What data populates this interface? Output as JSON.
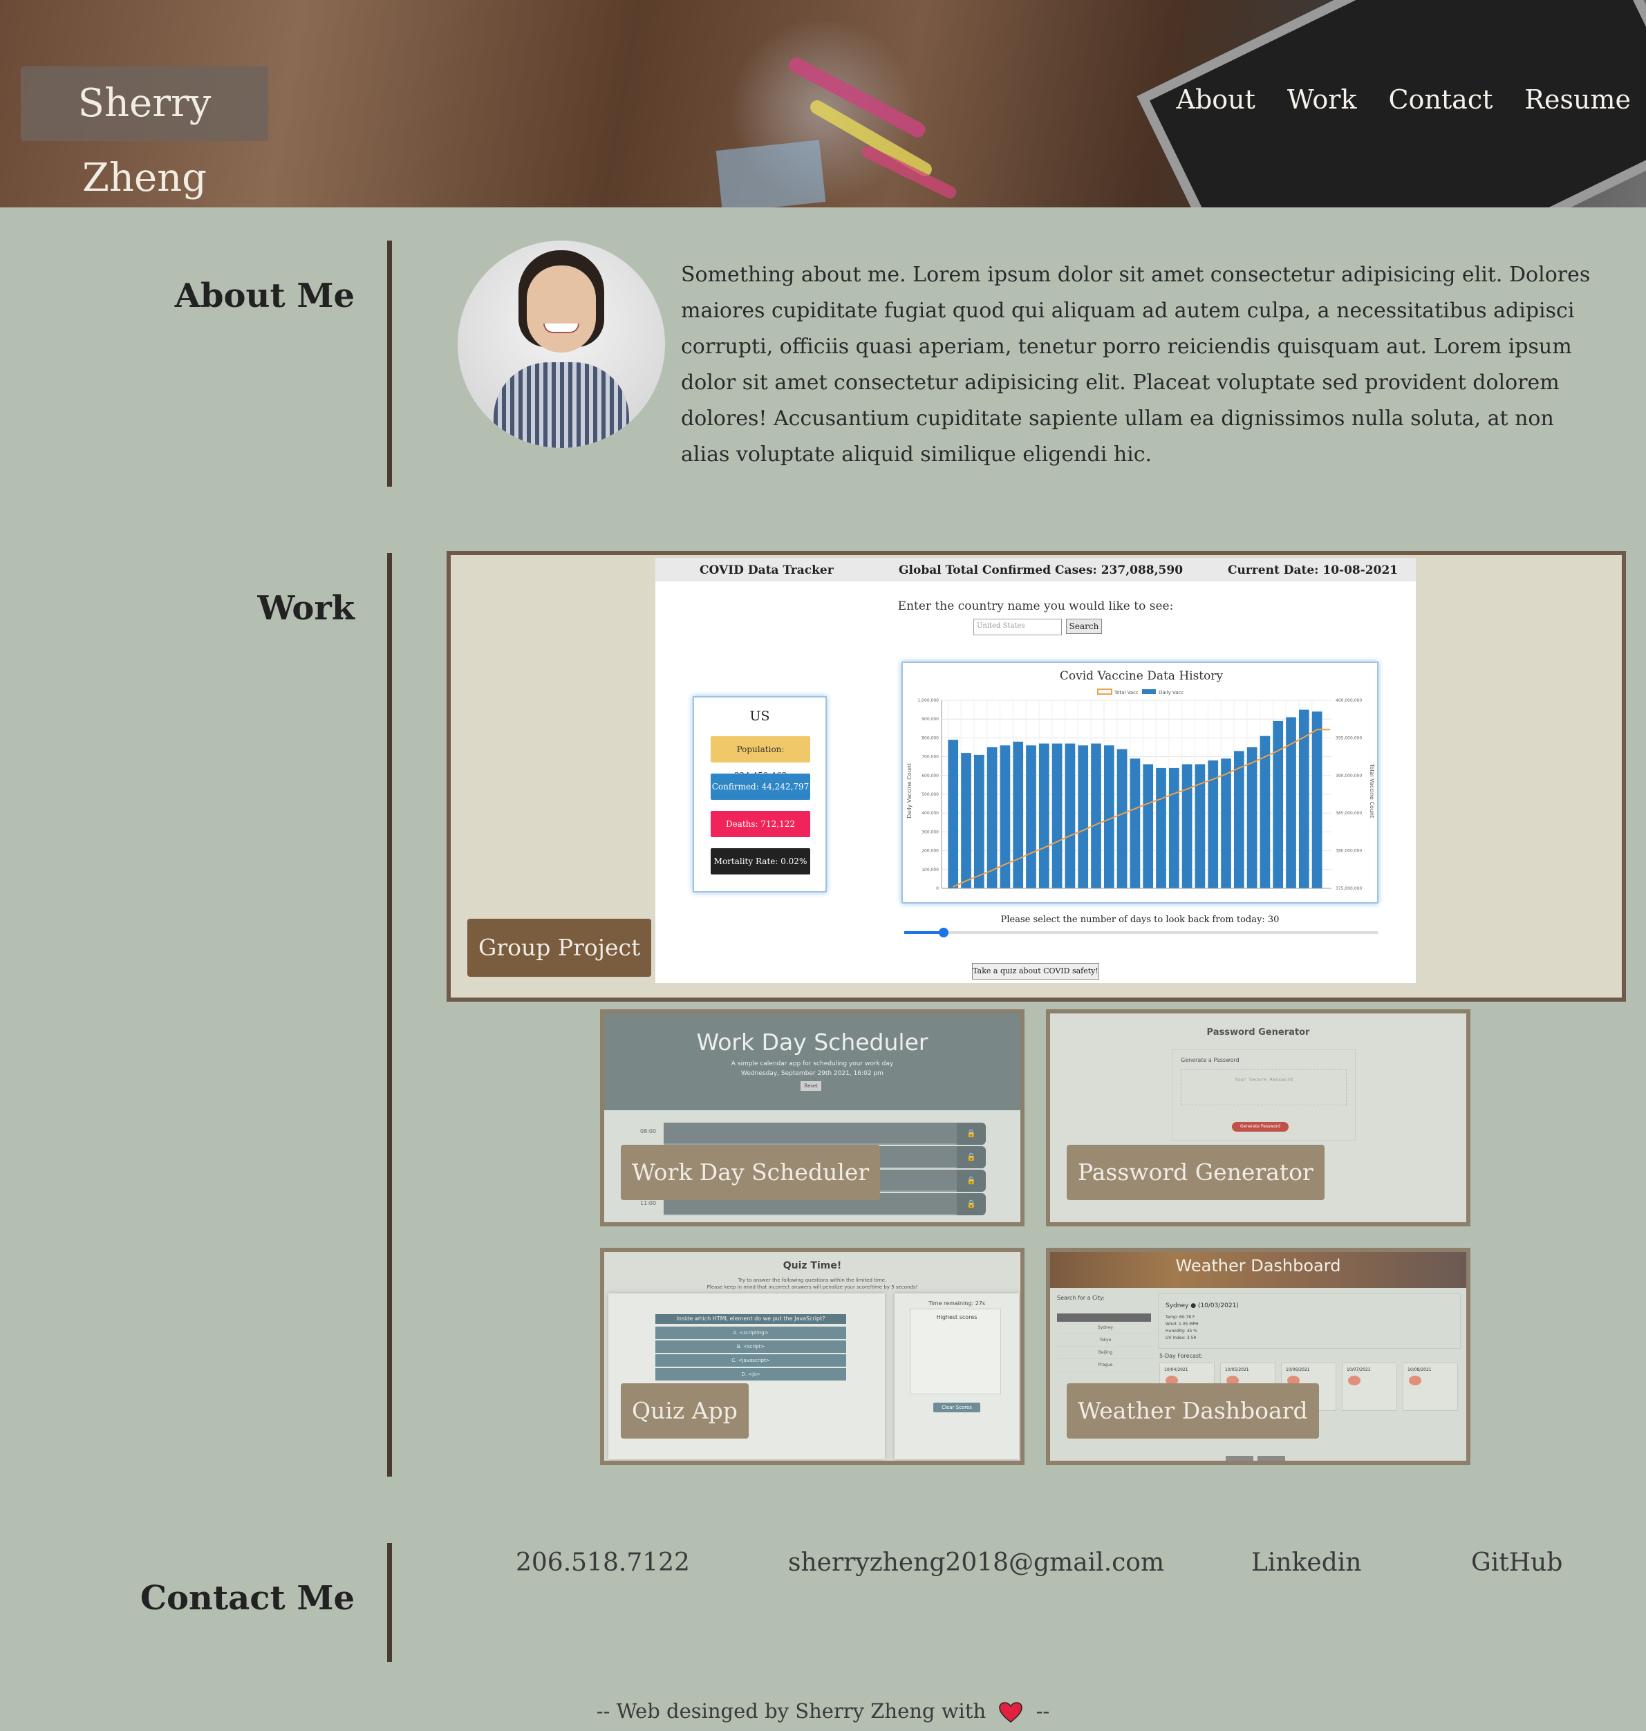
{
  "header": {
    "brand": "Sherry Zheng",
    "nav": [
      {
        "label": "About"
      },
      {
        "label": "Work"
      },
      {
        "label": "Contact"
      },
      {
        "label": "Resume"
      }
    ]
  },
  "about": {
    "title": "About Me",
    "text": "Something about me. Lorem ipsum dolor sit amet consectetur adipisicing elit. Dolores maiores cupiditate fugiat quod qui aliquam ad autem culpa, a necessitatibus adipisci corrupti, officiis quasi aperiam, tenetur porro reiciendis quisquam aut. Lorem ipsum dolor sit amet consectetur adipisicing elit. Placeat voluptate sed provident dolorem dolores! Accusantium cupiditate sapiente ullam ea dignissimos nulla soluta, at non alias voluptate aliquid similique eligendi hic."
  },
  "work": {
    "title": "Work",
    "featured": {
      "label": "Group Project",
      "screenshot": {
        "app_title": "COVID Data Tracker",
        "global_cases": "Global Total Confirmed Cases: 237,088,590",
        "current_date": "Current Date: 10-08-2021",
        "prompt": "Enter the country name you would like to see:",
        "input_placeholder": "United States",
        "search_button": "Search",
        "country": "US",
        "population": "Population: 324,459,463",
        "confirmed": "Confirmed: 44,242,797",
        "deaths": "Deaths: 712,122",
        "mortality": "Mortality Rate: 0.02%",
        "chart_title": "Covid Vaccine Data History",
        "legend_total": "Total Vacc",
        "legend_daily": "Daily Vacc",
        "y_left_label": "Daily Vaccine Count",
        "y_right_label": "Total Vaccine Count",
        "slider_label": "Please select the number of days to look back from today: 30",
        "quiz_button": "Take a quiz about COVID safety!"
      }
    },
    "projects": [
      {
        "label": "Work Day Scheduler"
      },
      {
        "label": "Password Generator"
      },
      {
        "label": "Quiz App"
      },
      {
        "label": "Weather Dashboard"
      }
    ],
    "scheduler": {
      "title": "Work Day Scheduler",
      "subtitle": "A simple calendar app for scheduling your work day",
      "date": "Wednesday, September 29th 2021, 16:02 pm",
      "reset": "Reset",
      "hours": [
        "08:00",
        "",
        "",
        "11:00"
      ]
    },
    "password": {
      "title": "Password Generator",
      "card_title": "Generate a Password",
      "placeholder": "Your Secure Password",
      "button": "Generate Password"
    },
    "quiz": {
      "title": "Quiz Time!",
      "sub1": "Try to answer the following questions within the limited time.",
      "sub2": "Please keep in mind that incorrect answers will penalize your score/time by 5 seconds!",
      "question": "Inside which HTML element do we put the JavaScript?",
      "answers": [
        "A. <scripting>",
        "B. <script>",
        "C. <javascript>",
        "D. <js>"
      ],
      "time": "Time remaining: 27s",
      "highscores": "Highest scores",
      "clear": "Clear Scores"
    },
    "weather": {
      "title": "Weather Dashboard",
      "search_label": "Search for a City:",
      "search_button": "Search",
      "cities": [
        "Sydney",
        "Tokyo",
        "Beijing",
        "Prague"
      ],
      "city": "Sydney",
      "city_date": "(10/03/2021)",
      "temp": "Temp: 60.78 F",
      "wind": "Wind: 1.05 MPH",
      "humidity": "Humidity: 45 %",
      "uv": "UV Index: 3.59",
      "forecast_label": "5-Day Forecast:",
      "forecast_dates": [
        "10/04/2021",
        "10/05/2021",
        "10/06/2021",
        "10/07/2021",
        "10/08/2021"
      ]
    }
  },
  "contact": {
    "title": "Contact Me",
    "phone": "206.518.7122",
    "email": "sherryzheng2018@gmail.com",
    "linkedin": "Linkedin",
    "github": "GitHub"
  },
  "footer": {
    "prefix": "-- Web desinged by Sherry Zheng with",
    "suffix": "--"
  },
  "colors": {
    "background": "#b4bfb2",
    "accent_bar": "#4a3a34",
    "label_dark": "#7a5c3e",
    "label_light": "#9a8a72",
    "population": "#f0c869",
    "confirmed": "#2f86c6",
    "deaths": "#f0245a",
    "mortality": "#222222",
    "bar_blue": "#2f7fc1",
    "line_orange": "#f0a04a"
  },
  "chart_data": {
    "type": "bar",
    "title": "Covid Vaccine Data History",
    "xlabel": "",
    "ylabel": "Daily Vaccine Count",
    "y2label": "Total Vaccine Count",
    "ylim": [
      0,
      1000000
    ],
    "y2lim": [
      375000000,
      400000000
    ],
    "yticks": [
      "0",
      "100,000",
      "200,000",
      "300,000",
      "400,000",
      "500,000",
      "600,000",
      "700,000",
      "800,000",
      "900,000",
      "1,000,000"
    ],
    "y2ticks": [
      "375,000,000",
      "380,000,000",
      "385,000,000",
      "390,000,000",
      "395,000,000",
      "400,000,000"
    ],
    "series": [
      {
        "name": "Daily Vacc",
        "type": "bar",
        "values": [
          790000,
          720000,
          710000,
          750000,
          760000,
          780000,
          760000,
          770000,
          770000,
          770000,
          760000,
          770000,
          760000,
          740000,
          690000,
          660000,
          640000,
          640000,
          660000,
          660000,
          680000,
          690000,
          730000,
          750000,
          810000,
          890000,
          910000,
          950000,
          940000
        ]
      },
      {
        "name": "Total Vacc",
        "type": "line",
        "values": [
          375200000,
          376000000,
          376700000,
          377400000,
          378200000,
          378900000,
          379700000,
          380400000,
          381200000,
          382000000,
          382700000,
          383500000,
          384200000,
          384900000,
          385600000,
          386300000,
          386900000,
          387600000,
          388200000,
          388900000,
          389500000,
          390200000,
          391000000,
          391700000,
          392500000,
          393300000,
          394200000,
          395100000,
          396100000,
          396100000
        ]
      }
    ]
  }
}
